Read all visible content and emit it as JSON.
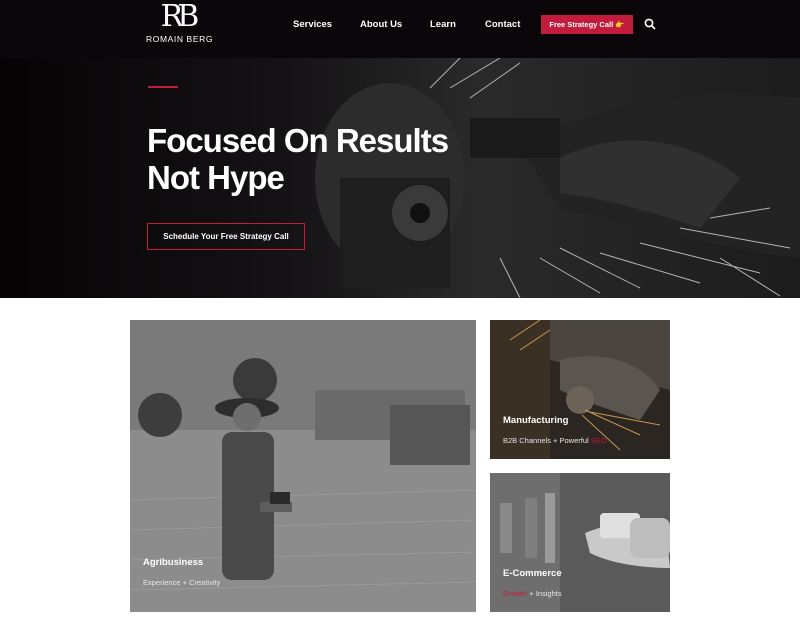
{
  "header": {
    "logo_mark": "RB",
    "logo_name": "ROMAIN BERG",
    "nav": [
      "Services",
      "About Us",
      "Learn",
      "Contact"
    ],
    "cta_label": "Free Strategy Call 👉",
    "search_icon": "search-icon"
  },
  "hero": {
    "title_line1": "Focused On Results",
    "title_line2": "Not Hype",
    "button_label": "Schedule Your Free Strategy Call"
  },
  "cards": [
    {
      "title": "Agribusiness",
      "sub_prefix": "Experience + Creativity",
      "sub_accent": "",
      "sub_suffix": ""
    },
    {
      "title": "Manufacturing",
      "sub_prefix": "B2B Channels + Powerful ",
      "sub_accent": "SEO",
      "sub_suffix": ""
    },
    {
      "title": "E-Commerce",
      "sub_prefix": "",
      "sub_accent": "Growth",
      "sub_suffix": " + Insights"
    }
  ],
  "colors": {
    "brand_red": "#c21b3b",
    "header_bg": "#0b0609"
  }
}
